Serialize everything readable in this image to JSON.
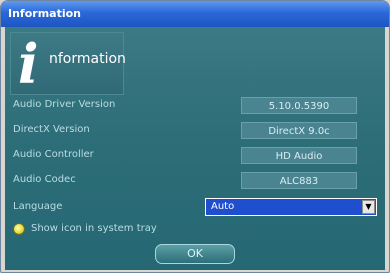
{
  "window": {
    "title": "Information"
  },
  "logo": {
    "letter": "i",
    "text": "nformation"
  },
  "info_rows": [
    {
      "label": "Audio Driver Version",
      "value": "5.10.0.5390"
    },
    {
      "label": "DirectX Version",
      "value": "DirectX 9.0c"
    },
    {
      "label": "Audio Controller",
      "value": "HD Audio"
    },
    {
      "label": "Audio Codec",
      "value": "ALC883"
    }
  ],
  "language": {
    "label": "Language",
    "selected": "Auto"
  },
  "tray": {
    "label": "Show icon in system tray",
    "checked": true
  },
  "buttons": {
    "ok": "OK"
  },
  "colors": {
    "titlebar": "#2a68d8",
    "panel": "#2d6e78",
    "selection": "#1f4fcf"
  }
}
